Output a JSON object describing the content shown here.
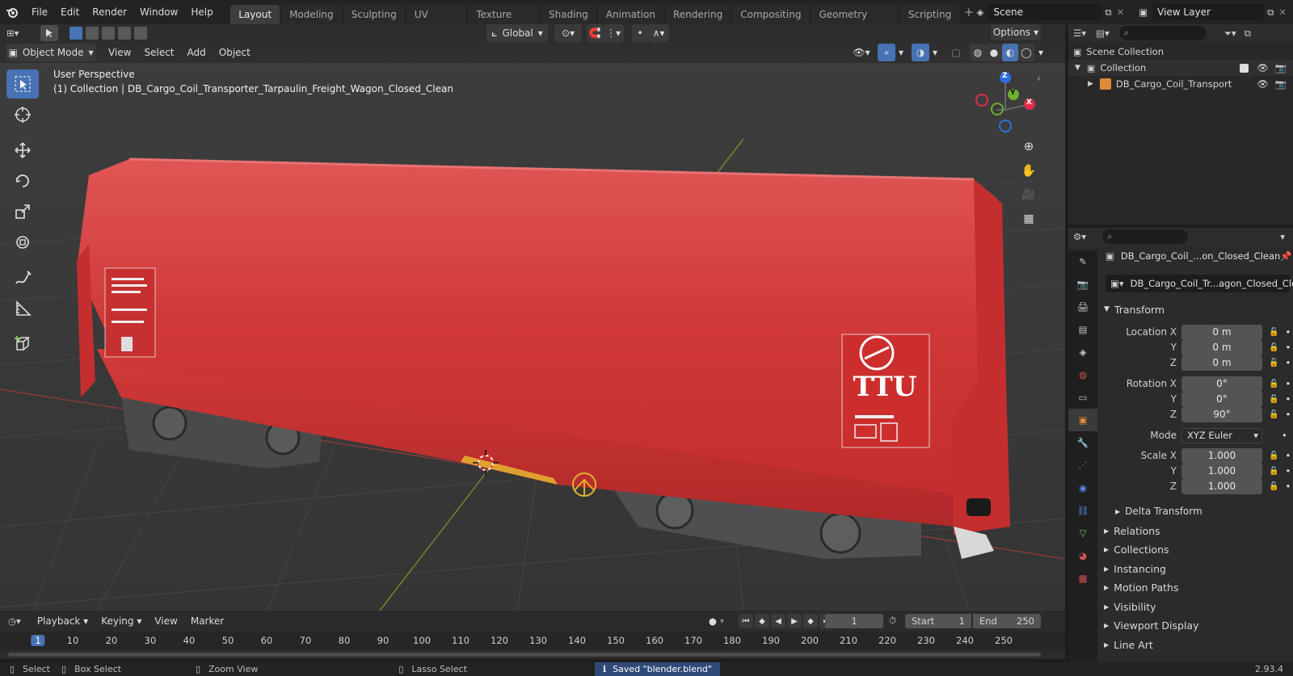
{
  "topbar": {
    "menus": [
      "File",
      "Edit",
      "Render",
      "Window",
      "Help"
    ],
    "workspaces": [
      "Layout",
      "Modeling",
      "Sculpting",
      "UV Editing",
      "Texture Paint",
      "Shading",
      "Animation",
      "Rendering",
      "Compositing",
      "Geometry Nodes",
      "Scripting"
    ],
    "active_workspace": "Layout",
    "scene": "Scene",
    "view_layer": "View Layer"
  },
  "tool_header": {
    "orientation": "Global",
    "options": "Options"
  },
  "viewport_header": {
    "mode": "Object Mode",
    "menus": [
      "View",
      "Select",
      "Add",
      "Object"
    ]
  },
  "viewport": {
    "perspective": "User Perspective",
    "collection_info": "(1) Collection | DB_Cargo_Coil_Transporter_Tarpaulin_Freight_Wagon_Closed_Clean",
    "wagon_logo": "TTU",
    "gizmo": {
      "x": "X",
      "y": "Y",
      "z": "Z"
    }
  },
  "outliner": {
    "scene_collection": "Scene Collection",
    "collection": "Collection",
    "object": "DB_Cargo_Coil_Transport"
  },
  "properties": {
    "object_name": "DB_Cargo_Coil_...on_Closed_Clean",
    "data_name": "DB_Cargo_Coil_Tr...agon_Closed_Clean",
    "transform_label": "Transform",
    "location_x_label": "Location X",
    "location_x": "0 m",
    "location_y": "0 m",
    "location_z": "0 m",
    "rotation_x_label": "Rotation X",
    "rotation_x": "0°",
    "rotation_y": "0°",
    "rotation_z": "90°",
    "mode_label": "Mode",
    "mode": "XYZ Euler",
    "scale_x_label": "Scale X",
    "scale_x": "1.000",
    "scale_y": "1.000",
    "scale_z": "1.000",
    "y_label": "Y",
    "z_label": "Z",
    "delta": "Delta Transform",
    "sections": [
      "Relations",
      "Collections",
      "Instancing",
      "Motion Paths",
      "Visibility",
      "Viewport Display",
      "Line Art"
    ]
  },
  "timeline": {
    "menus": [
      "Playback",
      "Keying",
      "View",
      "Marker"
    ],
    "current_frame": "1",
    "start_label": "Start",
    "start": "1",
    "end_label": "End",
    "end": "250",
    "ruler": [
      "1",
      "10",
      "20",
      "30",
      "40",
      "50",
      "60",
      "70",
      "80",
      "90",
      "100",
      "110",
      "120",
      "130",
      "140",
      "150",
      "160",
      "170",
      "180",
      "190",
      "200",
      "210",
      "220",
      "230",
      "240",
      "250"
    ]
  },
  "statusbar": {
    "select": "Select",
    "box_select": "Box Select",
    "zoom_view": "Zoom View",
    "lasso_select": "Lasso Select",
    "message": "Saved \"blender.blend\"",
    "version": "2.93.4"
  }
}
